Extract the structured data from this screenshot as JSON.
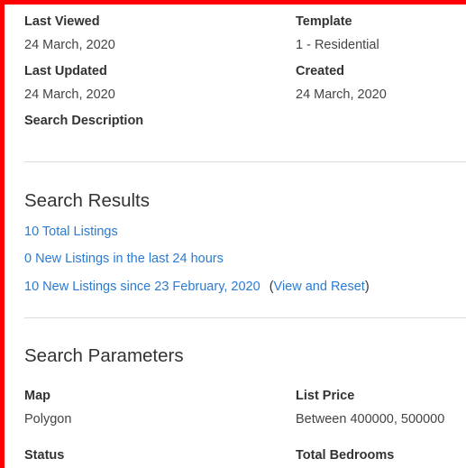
{
  "details": {
    "last_viewed_label": "Last Viewed",
    "last_viewed_value": "24 March, 2020",
    "template_label": "Template",
    "template_value": "1 - Residential",
    "last_updated_label": "Last Updated",
    "last_updated_value": "24 March, 2020",
    "created_label": "Created",
    "created_value": "24 March, 2020",
    "search_description_label": "Search Description"
  },
  "results": {
    "heading": "Search Results",
    "total_listings": "10 Total Listings",
    "new_24h": "0 New Listings in the last 24 hours",
    "new_since": "10 New Listings since 23 February, 2020",
    "paren_open": "(",
    "view_reset": "View and Reset",
    "paren_close": ")"
  },
  "parameters": {
    "heading": "Search Parameters",
    "map_label": "Map",
    "map_value": "Polygon",
    "list_price_label": "List Price",
    "list_price_value": "Between 400000, 500000",
    "status_label": "Status",
    "total_bedrooms_label": "Total Bedrooms"
  },
  "colors": {
    "frame": "#ff0000",
    "link": "#2a7bd3",
    "divider": "#dcdcdc"
  }
}
